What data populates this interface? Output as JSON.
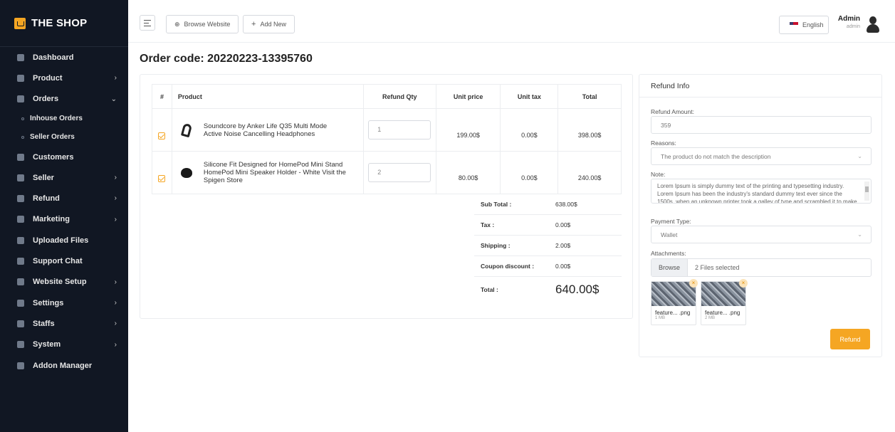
{
  "brand": {
    "name_prefix": "",
    "name": "THE SHOP"
  },
  "sidebar": {
    "items": [
      {
        "label": "Dashboard",
        "icon": "grid-icon",
        "chevron": ""
      },
      {
        "label": "Product",
        "icon": "box-icon",
        "chevron": "›"
      },
      {
        "label": "Orders",
        "icon": "list-icon",
        "chevron": "⌄"
      },
      {
        "label": "Inhouse Orders",
        "icon": "",
        "chevron": ""
      },
      {
        "label": "Seller Orders",
        "icon": "",
        "chevron": ""
      },
      {
        "label": "Customers",
        "icon": "users-icon",
        "chevron": ""
      },
      {
        "label": "Seller",
        "icon": "store-icon",
        "chevron": "›"
      },
      {
        "label": "Refund",
        "icon": "refund-icon",
        "chevron": "›"
      },
      {
        "label": "Marketing",
        "icon": "megaphone-icon",
        "chevron": "›"
      },
      {
        "label": "Uploaded Files",
        "icon": "folder-icon",
        "chevron": ""
      },
      {
        "label": "Support Chat",
        "icon": "chat-icon",
        "chevron": ""
      },
      {
        "label": "Website Setup",
        "icon": "monitor-icon",
        "chevron": "›"
      },
      {
        "label": "Settings",
        "icon": "gear-icon",
        "chevron": "›"
      },
      {
        "label": "Staffs",
        "icon": "person-icon",
        "chevron": "›"
      },
      {
        "label": "System",
        "icon": "system-icon",
        "chevron": "›"
      },
      {
        "label": "Addon Manager",
        "icon": "puzzle-icon",
        "chevron": ""
      }
    ]
  },
  "topbar": {
    "browse_label": "Browse Website",
    "add_label": "Add New",
    "language": "English",
    "user_name": "Admin",
    "user_role": "admin"
  },
  "page": {
    "title": "Order code: 20220223-13395760"
  },
  "table": {
    "headers": [
      "#",
      "Product",
      "Refund Qty",
      "Unit price",
      "Unit tax",
      "Total"
    ],
    "rows": [
      {
        "checked": true,
        "product": "Soundcore by Anker Life Q35 Multi Mode Active Noise Cancelling Headphones",
        "qty": "1",
        "unit_price": "199.00$",
        "unit_tax": "0.00$",
        "total": "398.00$"
      },
      {
        "checked": true,
        "product": "Silicone Fit Designed for HomePod Mini Stand HomePod Mini Speaker Holder - White Visit the Spigen Store",
        "qty": "2",
        "unit_price": "80.00$",
        "unit_tax": "0.00$",
        "total": "240.00$"
      }
    ]
  },
  "totals": {
    "sub_total_label": "Sub Total :",
    "sub_total": "638.00$",
    "tax_label": "Tax :",
    "tax": "0.00$",
    "shipping_label": "Shipping :",
    "shipping": "2.00$",
    "coupon_label": "Coupon discount :",
    "coupon": "0.00$",
    "grand_label": "Total :",
    "grand": "640.00$"
  },
  "refund": {
    "title": "Refund Info",
    "amount_label": "Refund Amount:",
    "amount": "359",
    "reasons_label": "Reasons:",
    "reason": "The product do not match the description",
    "note_label": "Note:",
    "note": "Lorem Ipsum is simply dummy text of the printing and typesetting industry. Lorem Ipsum has been the industry's standard dummy text ever since the 1500s, when an unknown printer took a galley of type and scrambled it to make a type specimen book. It has survived not only five centuries.",
    "payment_label": "Payment Type:",
    "payment": "Wallet",
    "attachments_label": "Attachments:",
    "browse_label": "Browse",
    "files_selected": "2 Files selected",
    "files": [
      {
        "name": "feature... .png",
        "size": "1 MB"
      },
      {
        "name": "feature... .png",
        "size": "2 MB"
      }
    ],
    "submit_label": "Refund"
  },
  "colors": {
    "accent": "#f5a623",
    "sidebar_bg": "#111723"
  }
}
